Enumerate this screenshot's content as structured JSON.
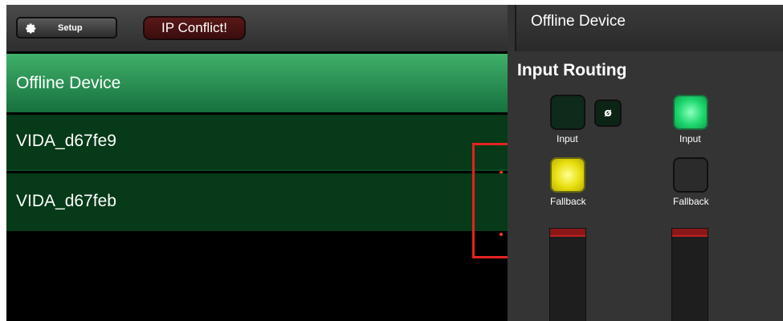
{
  "topbar": {
    "setup_label": "Setup",
    "ip_conflict_label": "IP Conflict!"
  },
  "devices": [
    {
      "name": "Offline Device",
      "selected": true
    },
    {
      "name": "VIDA_d67fe9",
      "selected": false,
      "indicator": true
    },
    {
      "name": "VIDA_d67feb",
      "selected": false,
      "indicator": true
    }
  ],
  "right_header": {
    "device_name": "Offline Device"
  },
  "routing": {
    "title": "Input Routing",
    "phase_label": "ø",
    "channels": [
      {
        "input_label": "Input",
        "fallback_label": "Fallback",
        "input_state": "off",
        "fallback_state": "yellow"
      },
      {
        "input_label": "Input",
        "fallback_label": "Fallback",
        "input_state": "green",
        "fallback_state": "off"
      }
    ]
  },
  "colors": {
    "selected_row": "#2e9a55",
    "row": "#063a18",
    "ip_conflict_bg": "#4a1212",
    "active_green": "#1fd86f",
    "fallback_yellow": "#e8df10",
    "highlight_box": "#e52222",
    "indicator_dot": "#ff3b1f"
  },
  "icons": {
    "setup": "gear-icon"
  }
}
